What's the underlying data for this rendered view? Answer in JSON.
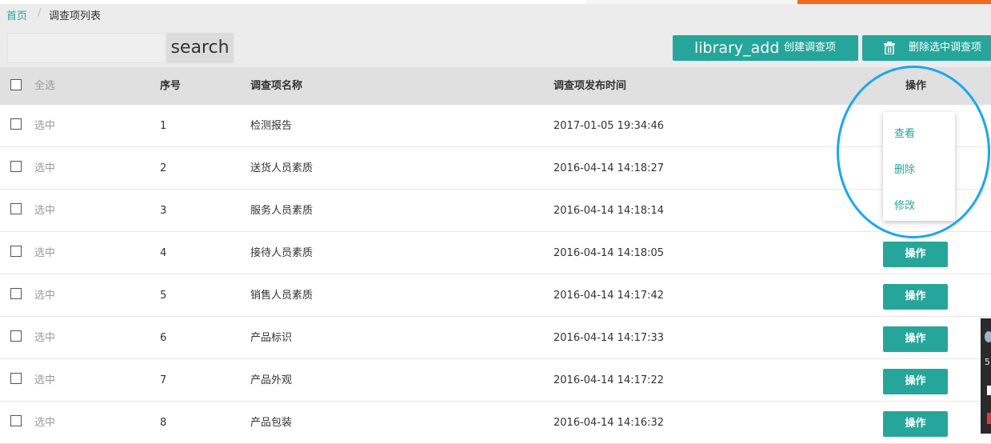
{
  "breadcrumb": {
    "home": "首页",
    "separator": "/",
    "current": "调查项列表"
  },
  "toolbar": {
    "search_placeholder": "",
    "search_label": "search",
    "create_icon": "library_add",
    "create_label": "创建调查项",
    "delete_label": "删除选中调查项"
  },
  "table": {
    "headers": {
      "select_all": "全选",
      "index": "序号",
      "name": "调查项名称",
      "time": "调查项发布时间",
      "actions": "操作"
    },
    "select_label": "选中",
    "action_label": "操作",
    "rows": [
      {
        "index": "1",
        "name": "检测报告",
        "time": "2017-01-05 19:34:46"
      },
      {
        "index": "2",
        "name": "送货人员素质",
        "time": "2016-04-14 14:18:27"
      },
      {
        "index": "3",
        "name": "服务人员素质",
        "time": "2016-04-14 14:18:14"
      },
      {
        "index": "4",
        "name": "接待人员素质",
        "time": "2016-04-14 14:18:05"
      },
      {
        "index": "5",
        "name": "销售人员素质",
        "time": "2016-04-14 14:17:42"
      },
      {
        "index": "6",
        "name": "产品标识",
        "time": "2016-04-14 14:17:33"
      },
      {
        "index": "7",
        "name": "产品外观",
        "time": "2016-04-14 14:17:22"
      },
      {
        "index": "8",
        "name": "产品包装",
        "time": "2016-04-14 14:16:32"
      }
    ]
  },
  "dropdown": {
    "view": "查看",
    "delete": "删除",
    "edit": "修改"
  },
  "side_widget": {
    "number": "5"
  },
  "colors": {
    "accent": "#26a69a",
    "highlight_circle": "#1aa7f0",
    "top_bar": "#f26a1b"
  }
}
